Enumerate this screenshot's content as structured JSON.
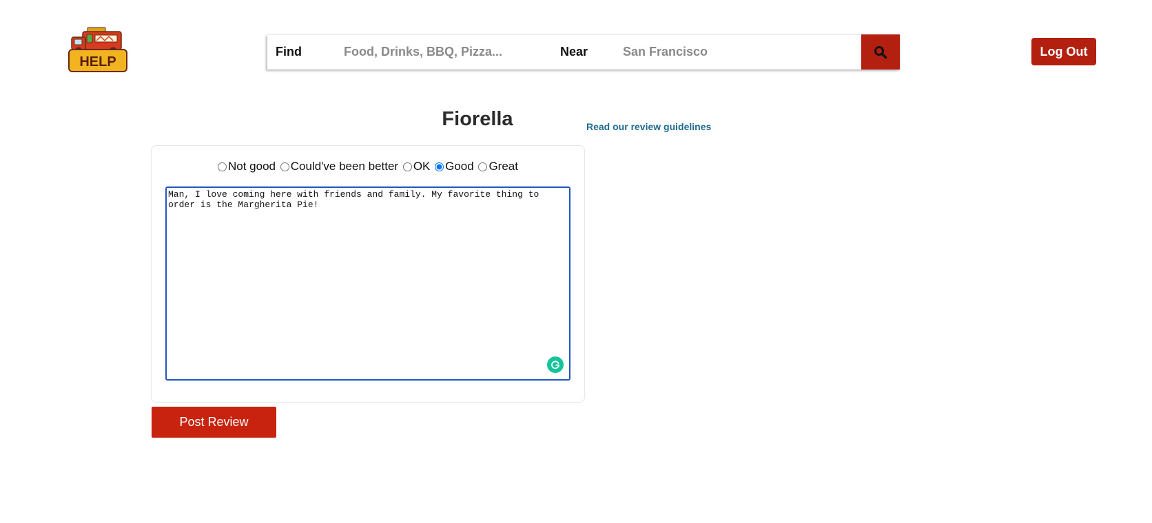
{
  "header": {
    "logo_text": "HELP",
    "search": {
      "find_label": "Find",
      "find_placeholder": "Food, Drinks, BBQ, Pizza...",
      "find_value": "",
      "near_label": "Near",
      "near_placeholder": "San Francisco",
      "near_value": "",
      "search_icon": "search-icon"
    },
    "logout_label": "Log Out"
  },
  "review": {
    "business_name": "Fiorella",
    "guidelines_link": "Read our review guidelines",
    "ratings": [
      {
        "label": "Not good",
        "selected": false
      },
      {
        "label": "Could've been better",
        "selected": false
      },
      {
        "label": "OK",
        "selected": false
      },
      {
        "label": "Good",
        "selected": true
      },
      {
        "label": "Great",
        "selected": false
      }
    ],
    "body_text": "Man, I love coming here with friends and family. My favorite thing to order is the Margherita Pie!",
    "grammarly_icon": "grammarly-icon",
    "post_label": "Post Review"
  },
  "colors": {
    "brand_red": "#b4200f",
    "post_red": "#c8230f",
    "link_blue": "#1f6b8f",
    "focus_blue": "#2155c4"
  }
}
